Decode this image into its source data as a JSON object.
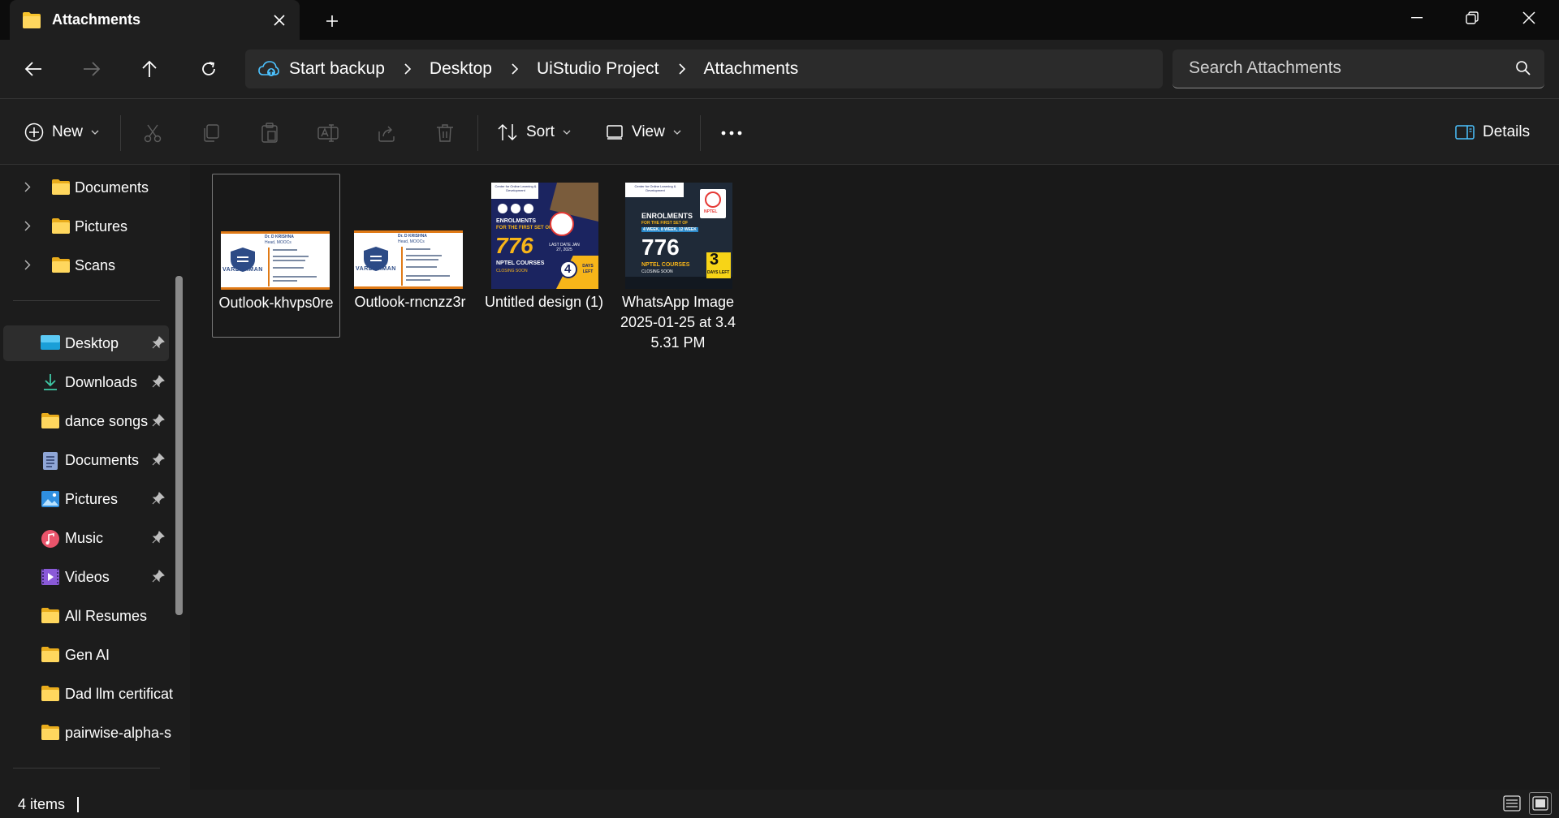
{
  "window": {
    "tab_title": "Attachments"
  },
  "nav": {
    "breadcrumb": [
      "Start backup",
      "Desktop",
      "UiStudio Project",
      "Attachments"
    ],
    "search_placeholder": "Search Attachments"
  },
  "toolbar": {
    "new_label": "New",
    "sort_label": "Sort",
    "view_label": "View",
    "details_label": "Details"
  },
  "sidebar": {
    "tree_items": [
      {
        "label": "Documents",
        "icon": "folder-icon"
      },
      {
        "label": "Pictures",
        "icon": "folder-icon"
      },
      {
        "label": "Scans",
        "icon": "folder-icon"
      }
    ],
    "quick_access": [
      {
        "label": "Desktop",
        "icon": "desktop-icon",
        "pinned": true
      },
      {
        "label": "Downloads",
        "icon": "download-icon",
        "pinned": true
      },
      {
        "label": "dance songs",
        "icon": "folder-icon",
        "pinned": true
      },
      {
        "label": "Documents",
        "icon": "document-icon",
        "pinned": true
      },
      {
        "label": "Pictures",
        "icon": "pictures-icon",
        "pinned": true
      },
      {
        "label": "Music",
        "icon": "music-icon",
        "pinned": true
      },
      {
        "label": "Videos",
        "icon": "videos-icon",
        "pinned": true
      },
      {
        "label": "All Resumes",
        "icon": "folder-icon",
        "pinned": false
      },
      {
        "label": "Gen AI",
        "icon": "folder-icon",
        "pinned": false
      },
      {
        "label": "Dad llm certificat",
        "icon": "folder-icon",
        "pinned": false
      },
      {
        "label": "pairwise-alpha-s",
        "icon": "folder-icon",
        "pinned": false
      }
    ]
  },
  "files": [
    {
      "name": "Outlook-khvps0re",
      "kind": "business-card"
    },
    {
      "name": "Outlook-rncnzz3r",
      "kind": "business-card"
    },
    {
      "name": "Untitled design (1)",
      "kind": "poster"
    },
    {
      "name": "WhatsApp Image 2025-01-25 at 3.45.31 PM",
      "kind": "poster"
    }
  ],
  "thumbs": {
    "card_name": "Dr. D KRISHNA",
    "card_role": "Head, MOOCs",
    "card_org": "VARDHAMAN",
    "poster1": {
      "header": "Center for Online Learning & Development",
      "line1": "ENROLMENTS",
      "line2": "FOR THE FIRST SET OF",
      "big": "776",
      "courses": "NPTEL COURSES",
      "closing": "CLOSING SOON",
      "last_date": "LAST DATE JAN 27, 2025",
      "days": "4",
      "days_label": "DAYS LEFT"
    },
    "poster2": {
      "header": "Center for Online Learning & Development",
      "line1": "ENROLMENTS",
      "line2": "FOR THE FIRST SET OF",
      "line3": "4 WEEK, 8 WEEK, 12 WEEK",
      "big": "776",
      "courses": "NPTEL COURSES",
      "closing": "CLOSING SOON",
      "days": "3",
      "days_label": "DAYS LEFT",
      "badge": "NPTEL"
    }
  },
  "status": {
    "items_count": "4 items"
  },
  "colors": {
    "folder": "#f8c42c",
    "accent_blue": "#4cc2ff",
    "background": "#191919"
  }
}
